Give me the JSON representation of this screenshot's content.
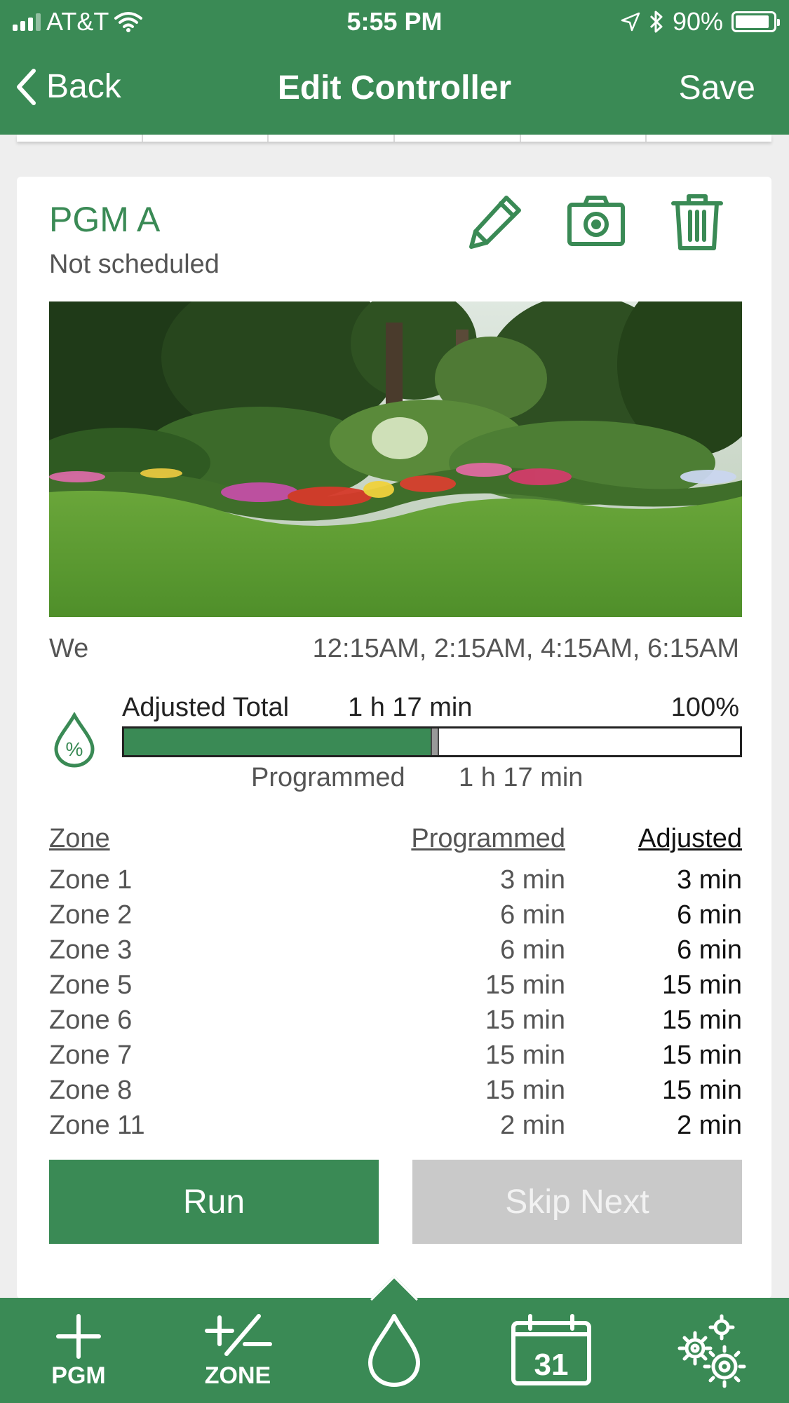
{
  "status_bar": {
    "carrier": "AT&T",
    "time": "5:55 PM",
    "battery": "90%",
    "battery_level": 0.9,
    "icons": [
      "signal-icon",
      "wifi-icon",
      "location-icon",
      "bluetooth-icon",
      "battery-icon"
    ]
  },
  "nav": {
    "back_label": "Back",
    "title": "Edit Controller",
    "save_label": "Save"
  },
  "program": {
    "name": "PGM A",
    "schedule_status": "Not scheduled",
    "actions": [
      "edit-pencil-icon",
      "camera-icon",
      "trash-icon"
    ],
    "days": "We",
    "start_times": "12:15AM, 2:15AM, 4:15AM, 6:15AM",
    "adjusted_label": "Adjusted Total",
    "adjusted_total": "1 h 17 min",
    "adjust_percent": "100%",
    "adjust_fraction": 0.5,
    "programmed_label": "Programmed",
    "programmed_total": "1 h 17 min"
  },
  "zones": {
    "headers": {
      "zone": "Zone",
      "programmed": "Programmed",
      "adjusted": "Adjusted"
    },
    "rows": [
      {
        "zone": "Zone 1",
        "programmed": "3 min",
        "adjusted": "3 min"
      },
      {
        "zone": "Zone 2",
        "programmed": "6 min",
        "adjusted": "6 min"
      },
      {
        "zone": "Zone 3",
        "programmed": "6 min",
        "adjusted": "6 min"
      },
      {
        "zone": "Zone 5",
        "programmed": "15 min",
        "adjusted": "15 min"
      },
      {
        "zone": "Zone 6",
        "programmed": "15 min",
        "adjusted": "15 min"
      },
      {
        "zone": "Zone 7",
        "programmed": "15 min",
        "adjusted": "15 min"
      },
      {
        "zone": "Zone 8",
        "programmed": "15 min",
        "adjusted": "15 min"
      },
      {
        "zone": "Zone 11",
        "programmed": "2 min",
        "adjusted": "2 min"
      }
    ]
  },
  "buttons": {
    "run": "Run",
    "skip_next": "Skip Next"
  },
  "toolbar": {
    "pgm_label": "PGM",
    "zone_label": "ZONE",
    "calendar_day": "31",
    "items": [
      "add-program-icon",
      "add-zone-icon",
      "water-drop-icon",
      "calendar-icon",
      "settings-gears-icon"
    ]
  },
  "colors": {
    "brand_green": "#3a8a55",
    "disabled_gray": "#c9c9c9"
  }
}
